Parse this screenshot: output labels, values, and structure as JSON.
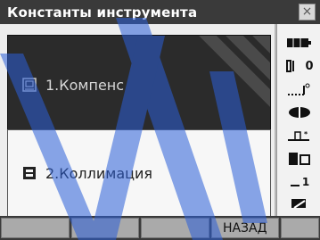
{
  "window": {
    "title": "Константы инструмента",
    "close_label": "×"
  },
  "list": {
    "items": [
      {
        "label": "1.Компенс",
        "icon": "calibration-icon",
        "selected": true
      },
      {
        "label": "2.Коллимация",
        "icon": "collimation-icon",
        "selected": false
      }
    ]
  },
  "sidebar": {
    "icons": [
      "battery-icon",
      "target-constant-icon",
      "tilt-level-icon",
      "laser-icon",
      "prism-icon",
      "mode-icon",
      "page-indicator-icon",
      "keyboard-icon"
    ],
    "prism_constant": "0",
    "page_number": "1"
  },
  "softkeys": {
    "f1": "",
    "f2": "",
    "f3": "",
    "f4": "НАЗАД"
  },
  "colors": {
    "accent": "#2b5fd9",
    "titlebar": "#3a3a3a",
    "selection": "#2b2b2b"
  }
}
